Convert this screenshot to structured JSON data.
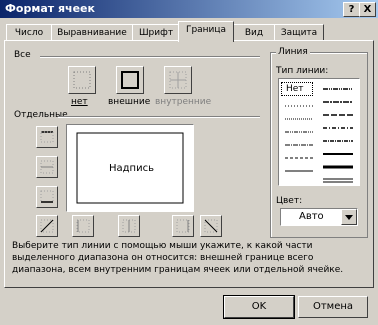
{
  "window": {
    "title": "Формат ячеек",
    "help_label": "?",
    "close_label": "X"
  },
  "tabs": [
    {
      "label": "Число"
    },
    {
      "label": "Выравнивание"
    },
    {
      "label": "Шрифт"
    },
    {
      "label": "Граница"
    },
    {
      "label": "Вид"
    },
    {
      "label": "Защита"
    }
  ],
  "presets": {
    "group_label": "Все",
    "items": [
      {
        "label": "нет"
      },
      {
        "label": "внешние"
      },
      {
        "label": "внутренние"
      }
    ]
  },
  "border": {
    "group_label": "Отдельные",
    "preview_text": "Надпись"
  },
  "line": {
    "group_label": "Линия",
    "type_label": "Тип линии:",
    "none_label": "Нет",
    "color_label": "Цвет:",
    "color_value": "Авто"
  },
  "hint": "Выберите тип линии с помощью мыши укажите, к какой части выделенного диапазона он относится: внешней границе всего диапазона, всем внутренним границам ячеек или отдельной ячейке.",
  "buttons": {
    "ok": "OK",
    "cancel": "Отмена"
  },
  "colors": {
    "titlebar_start": "#0a246a",
    "titlebar_end": "#a6caf0",
    "face": "#d4d0c8"
  }
}
